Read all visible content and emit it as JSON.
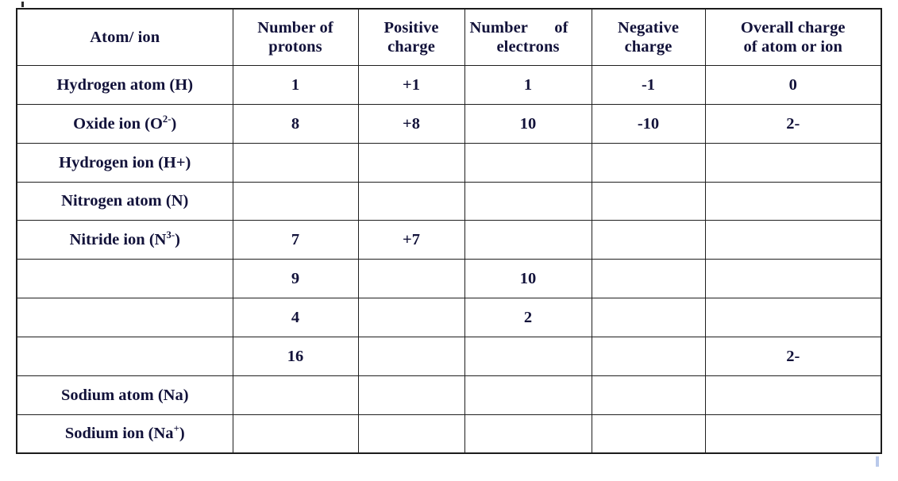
{
  "document": {
    "type": "worksheet-table",
    "title": "Atom / ion charge table"
  },
  "table": {
    "headers": [
      {
        "line1": "Atom/ ion",
        "line2": ""
      },
      {
        "line1": "Number of",
        "line2": "protons"
      },
      {
        "line1": "Positive",
        "line2": "charge"
      },
      {
        "line1": "Number",
        "line1b": "of",
        "line2": "electrons"
      },
      {
        "line1": "Negative",
        "line2": "charge"
      },
      {
        "line1": "Overall charge",
        "line2": "of atom or ion"
      }
    ],
    "rows": [
      {
        "species_prefix": "Hydrogen atom (H)",
        "species_sup": "",
        "species_suffix": "",
        "protons": "1",
        "positive_charge": "+1",
        "electrons": "1",
        "negative_charge": "-1",
        "overall_charge": "0"
      },
      {
        "species_prefix": "Oxide ion (O",
        "species_sup": "2-",
        "species_suffix": ")",
        "protons": "8",
        "positive_charge": "+8",
        "electrons": "10",
        "negative_charge": "-10",
        "overall_charge": "2-"
      },
      {
        "species_prefix": "Hydrogen ion (H+)",
        "species_sup": "",
        "species_suffix": "",
        "protons": "",
        "positive_charge": "",
        "electrons": "",
        "negative_charge": "",
        "overall_charge": ""
      },
      {
        "species_prefix": "Nitrogen atom (N)",
        "species_sup": "",
        "species_suffix": "",
        "protons": "",
        "positive_charge": "",
        "electrons": "",
        "negative_charge": "",
        "overall_charge": ""
      },
      {
        "species_prefix": "Nitride ion (N",
        "species_sup": "3-",
        "species_suffix": ")",
        "protons": "7",
        "positive_charge": "+7",
        "electrons": "",
        "negative_charge": "",
        "overall_charge": ""
      },
      {
        "species_prefix": "",
        "species_sup": "",
        "species_suffix": "",
        "protons": "9",
        "positive_charge": "",
        "electrons": "10",
        "negative_charge": "",
        "overall_charge": ""
      },
      {
        "species_prefix": "",
        "species_sup": "",
        "species_suffix": "",
        "protons": "4",
        "positive_charge": "",
        "electrons": "2",
        "negative_charge": "",
        "overall_charge": ""
      },
      {
        "species_prefix": "",
        "species_sup": "",
        "species_suffix": "",
        "protons": "16",
        "positive_charge": "",
        "electrons": "",
        "negative_charge": "",
        "overall_charge": "2-"
      },
      {
        "species_prefix": "Sodium atom (Na)",
        "species_sup": "",
        "species_suffix": "",
        "protons": "",
        "positive_charge": "",
        "electrons": "",
        "negative_charge": "",
        "overall_charge": ""
      },
      {
        "species_prefix": "Sodium ion (Na",
        "species_sup": "+",
        "species_suffix": ")",
        "protons": "",
        "positive_charge": "",
        "electrons": "",
        "negative_charge": "",
        "overall_charge": ""
      }
    ]
  },
  "colors": {
    "border": "#1f1f1f",
    "text": "#12123a",
    "background": "#ffffff",
    "scan_mark": "#aebfe8"
  }
}
